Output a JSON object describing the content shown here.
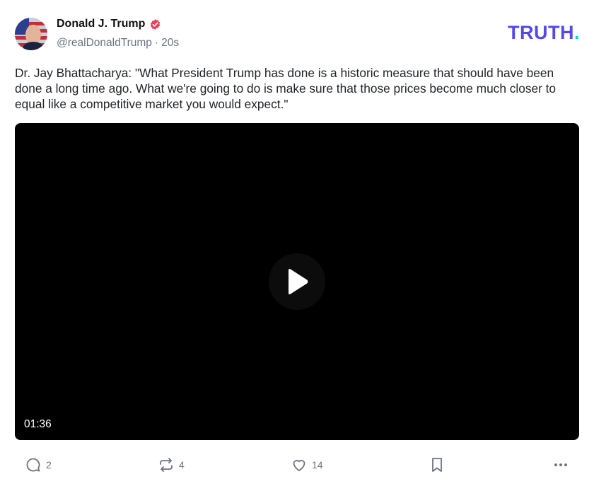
{
  "author": {
    "display_name": "Donald J. Trump",
    "handle": "@realDonaldTrump",
    "separator": "·",
    "time_ago": "20s",
    "verified_badge_color": "#e9425d"
  },
  "brand": {
    "logo_text": "TRUTH",
    "logo_dot": ".",
    "logo_color": "#5448ee",
    "logo_dot_color": "#16d1c6"
  },
  "post": {
    "text": "Dr. Jay Bhattacharya: \"What President Trump has done is a historic measure that should have been done a long time ago. What we're going to do is make sure that those prices become much closer to equal like a competitive market you would expect.\""
  },
  "video": {
    "duration": "01:36",
    "icon": "play-icon"
  },
  "actions": {
    "replies": {
      "icon": "reply-icon",
      "count": "2"
    },
    "retruths": {
      "icon": "retruth-icon",
      "count": "4"
    },
    "likes": {
      "icon": "heart-icon",
      "count": "14"
    },
    "bookmark": {
      "icon": "bookmark-icon"
    },
    "more": {
      "icon": "more-icon"
    }
  }
}
